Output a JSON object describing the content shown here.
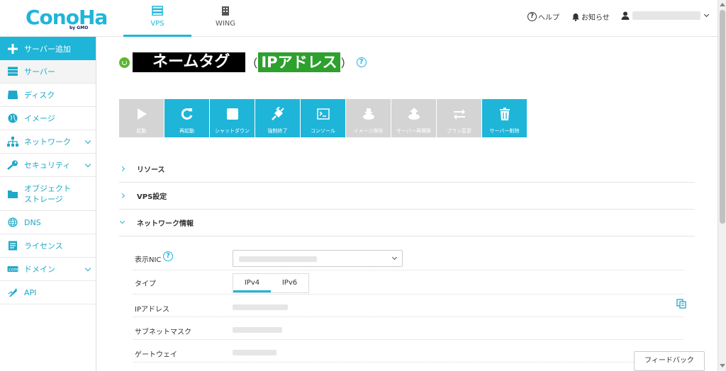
{
  "brand": {
    "logo": "ConoHa",
    "sub": "by GMO"
  },
  "nav": {
    "vps_label": "VPS",
    "wing_label": "WING"
  },
  "header": {
    "help_label": "ヘルプ",
    "notice_label": "お知らせ"
  },
  "sidebar": {
    "items": [
      {
        "label": "サーバー追加"
      },
      {
        "label": "サーバー"
      },
      {
        "label": "ディスク"
      },
      {
        "label": "イメージ"
      },
      {
        "label": "ネットワーク"
      },
      {
        "label": "セキュリティ"
      },
      {
        "label": "オブジェクト\nストレージ"
      },
      {
        "label": "DNS"
      },
      {
        "label": "ライセンス"
      },
      {
        "label": "ドメイン"
      },
      {
        "label": "API"
      }
    ]
  },
  "server": {
    "name_tag": "ネームタグ",
    "ip_tag": "IPアドレス",
    "paren_open": "（",
    "paren_close": "）"
  },
  "toolbar": {
    "buttons": [
      {
        "label": "起動",
        "icon": "play-icon",
        "enabled": false
      },
      {
        "label": "再起動",
        "icon": "restart-icon",
        "enabled": true
      },
      {
        "label": "シャットダウン",
        "icon": "stop-icon",
        "enabled": true
      },
      {
        "label": "強制終了",
        "icon": "plug-icon",
        "enabled": true
      },
      {
        "label": "コンソール",
        "icon": "console-icon",
        "enabled": true
      },
      {
        "label": "イメージ保存",
        "icon": "save-image-icon",
        "enabled": false
      },
      {
        "label": "サーバー再構築",
        "icon": "rebuild-icon",
        "enabled": false
      },
      {
        "label": "プラン変更",
        "icon": "swap-icon",
        "enabled": false
      },
      {
        "label": "サーバー削除",
        "icon": "trash-icon",
        "enabled": true
      }
    ]
  },
  "sections": [
    {
      "label": "リソース",
      "open": false
    },
    {
      "label": "VPS設定",
      "open": false
    },
    {
      "label": "ネットワーク情報",
      "open": true
    }
  ],
  "network": {
    "nic_label": "表示NIC",
    "type_label": "タイプ",
    "type_options": [
      "IPv4",
      "IPv6"
    ],
    "type_selected": "IPv4",
    "ip_label": "IPアドレス",
    "subnet_label": "サブネットマスク",
    "gateway_label": "ゲートウェイ"
  },
  "feedback_label": "フィードバック",
  "colors": {
    "accent": "#1fb5d9",
    "disabled": "#d4d4d4",
    "power": "#5cb531",
    "ip_tag": "#2da02d"
  }
}
